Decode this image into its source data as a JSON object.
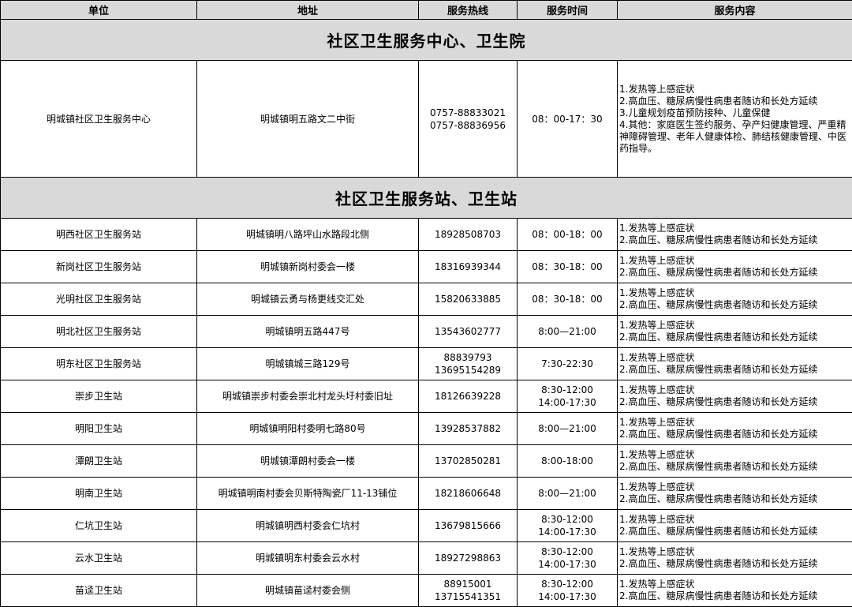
{
  "headers": {
    "unit": "单位",
    "address": "地址",
    "hotline": "服务热线",
    "hours": "服务时间",
    "content": "服务内容"
  },
  "sections": [
    {
      "title": "社区卫生服务中心、卫生院"
    },
    {
      "title": "社区卫生服务站、卫生站"
    }
  ],
  "center": {
    "unit": "明城镇社区卫生服务中心",
    "address": "明城镇明五路文二中街",
    "phone1": "0757-88833021",
    "phone2": "0757-88836956",
    "hours": "08：00-17：30",
    "content": [
      "1.发热等上感症状",
      "2.高血压、糖尿病慢性病患者随访和长处方延续",
      "3.儿童规划疫苗预防接种、儿童保健",
      "4.其他：家庭医生签约服务、孕产妇健康管理、严重精神障碍管理、老年人健康体检、肺结核健康管理、中医药指导。"
    ]
  },
  "stations": [
    {
      "unit": "明西社区卫生服务站",
      "address": "明城镇明八路坪山水路段北侧",
      "phone1": "18928508703",
      "phone2": "",
      "hours1": "08：00-18：00",
      "hours2": ""
    },
    {
      "unit": "新岗社区卫生服务站",
      "address": "明城镇新岗村委会一楼",
      "phone1": "18316939344",
      "phone2": "",
      "hours1": "08：30-18：00",
      "hours2": ""
    },
    {
      "unit": "光明社区卫生服务站",
      "address": "明城镇云勇与杨更线交汇处",
      "phone1": "15820633885",
      "phone2": "",
      "hours1": "08：30-18：00",
      "hours2": ""
    },
    {
      "unit": "明北社区卫生服务站",
      "address": "明城镇明五路447号",
      "phone1": "13543602777",
      "phone2": "",
      "hours1": "8:00—21:00",
      "hours2": ""
    },
    {
      "unit": "明东社区卫生服务站",
      "address": "明城镇城三路129号",
      "phone1": "88839793",
      "phone2": "13695154289",
      "hours1": "7:30-22:30",
      "hours2": ""
    },
    {
      "unit": "崇步卫生站",
      "address": "明城镇崇步村委会崇北村龙头圩村委旧址",
      "phone1": "18126639228",
      "phone2": "",
      "hours1": "8:30-12:00",
      "hours2": "14:00-17:30"
    },
    {
      "unit": "明阳卫生站",
      "address": "明城镇明阳村委明七路80号",
      "phone1": "13928537882",
      "phone2": "",
      "hours1": "8:00—21:00",
      "hours2": ""
    },
    {
      "unit": "潭朗卫生站",
      "address": "明城镇潭朗村委会一楼",
      "phone1": "13702850281",
      "phone2": "",
      "hours1": "8:00-18:00",
      "hours2": ""
    },
    {
      "unit": "明南卫生站",
      "address": "明城镇明南村委会贝斯特陶瓷厂11-13铺位",
      "phone1": "18218606648",
      "phone2": "",
      "hours1": "8:00—21:00",
      "hours2": ""
    },
    {
      "unit": "仁坑卫生站",
      "address": "明城镇明西村委会仁坑村",
      "phone1": "13679815666",
      "phone2": "",
      "hours1": "8:30-12:00",
      "hours2": "14:00-17:30"
    },
    {
      "unit": "云水卫生站",
      "address": "明城镇明东村委会云水村",
      "phone1": "18927298863",
      "phone2": "",
      "hours1": "8:30-12:00",
      "hours2": "14:00-17:30"
    },
    {
      "unit": "苗迳卫生站",
      "address": "明城镇苗迳村委会侧",
      "phone1": "88915001",
      "phone2": "13715541351",
      "hours1": "8:30-12:00",
      "hours2": "14:00-17:30"
    }
  ],
  "station_content": [
    "1.发热等上感症状",
    "2.高血压、糖尿病慢性病患者随访和长处方延续"
  ]
}
